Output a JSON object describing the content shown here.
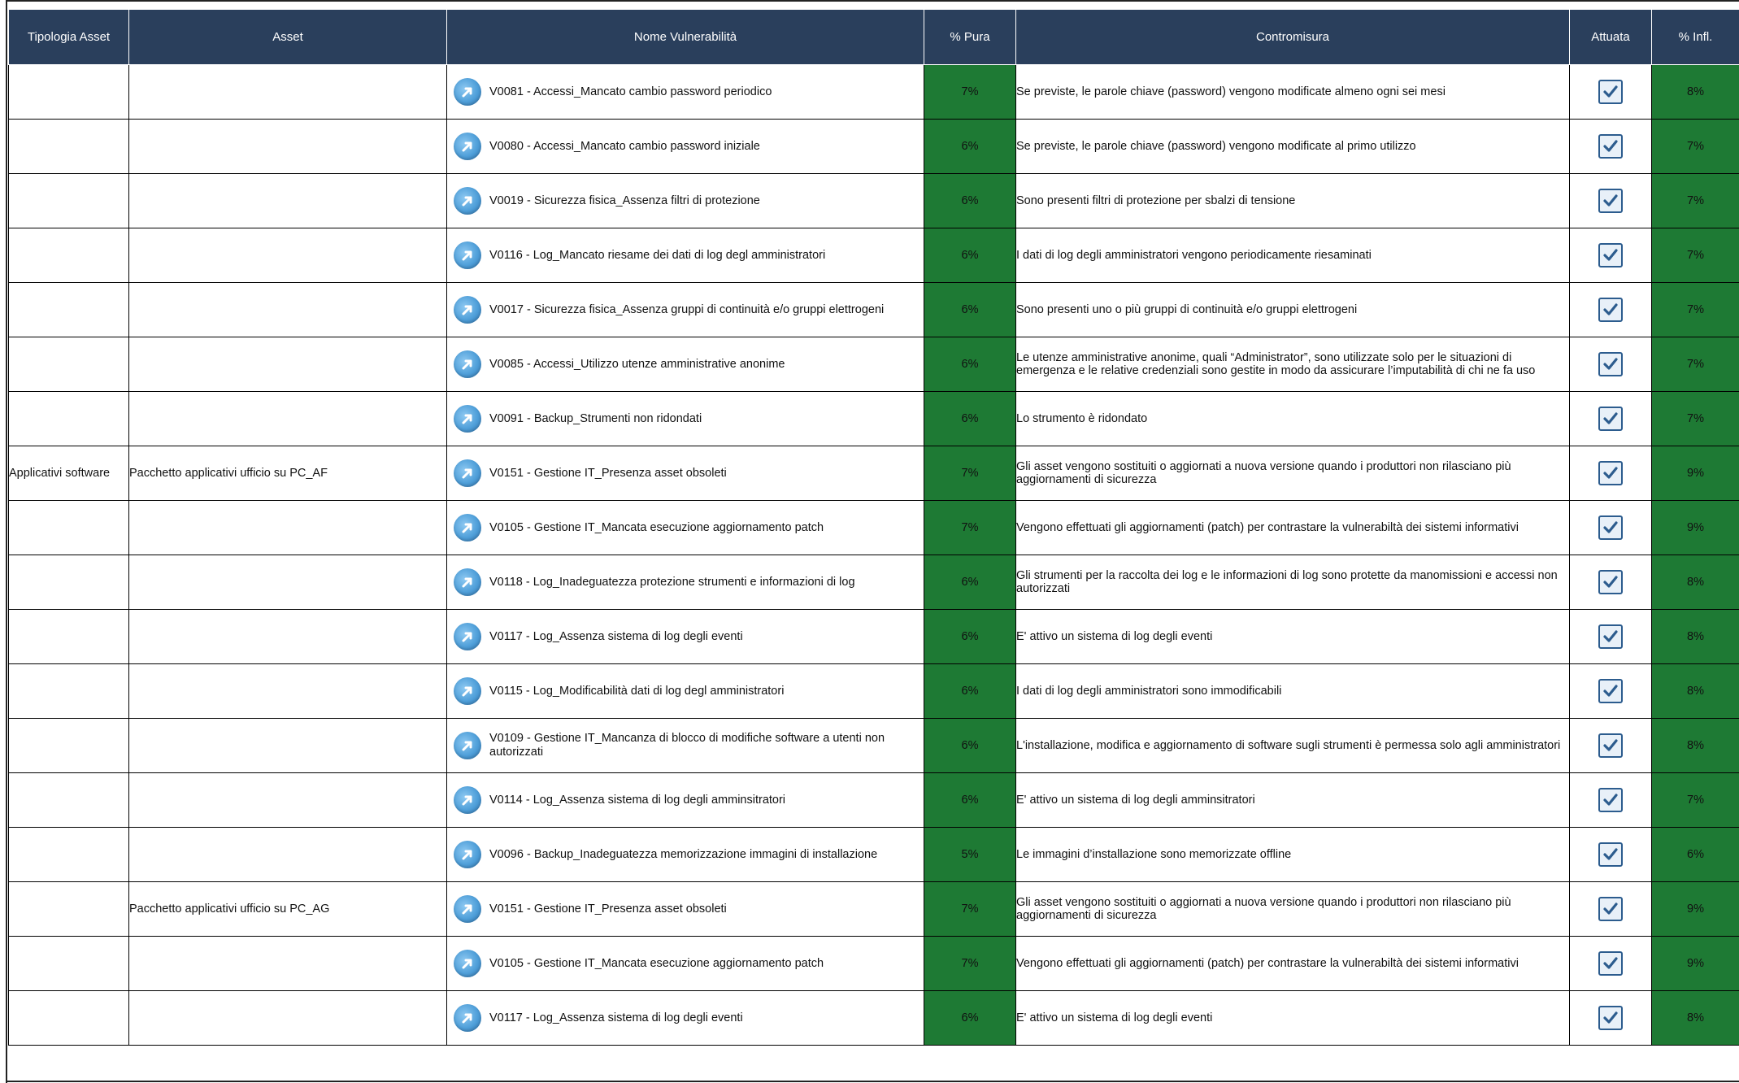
{
  "headers": {
    "tipologia": "Tipologia Asset",
    "asset": "Asset",
    "nome": "Nome Vulnerabilità",
    "pura": "% Pura",
    "contromisura": "Contromisura",
    "attuata": "Attuata",
    "infl": "% Infl."
  },
  "colors": {
    "header_bg": "#2a3f5c",
    "pct_bg": "#1e7a34",
    "pct_text": "#0b4d1d",
    "icon_blue": "#4f9fd9"
  },
  "icons": {
    "vuln": "arrow-circle-icon",
    "attuata": "checkbox-checked-icon"
  },
  "rows": [
    {
      "tipologia": "",
      "asset": "",
      "nome": "V0081 - Accessi_Mancato cambio password periodico",
      "pura": "7%",
      "contromisura": "Se previste, le parole chiave (password) vengono modificate almeno ogni sei mesi",
      "attuata": true,
      "infl": "8%"
    },
    {
      "tipologia": "",
      "asset": "",
      "nome": "V0080 - Accessi_Mancato cambio password iniziale",
      "pura": "6%",
      "contromisura": "Se previste, le parole chiave (password) vengono modificate al primo utilizzo",
      "attuata": true,
      "infl": "7%"
    },
    {
      "tipologia": "",
      "asset": "",
      "nome": "V0019 - Sicurezza fisica_Assenza filtri di protezione",
      "pura": "6%",
      "contromisura": "Sono presenti filtri di protezione per sbalzi di tensione",
      "attuata": true,
      "infl": "7%"
    },
    {
      "tipologia": "",
      "asset": "",
      "nome": "V0116 - Log_Mancato riesame dei dati di log degl amministratori",
      "pura": "6%",
      "contromisura": "I dati di log degli amministratori vengono periodicamente riesaminati",
      "attuata": true,
      "infl": "7%"
    },
    {
      "tipologia": "",
      "asset": "",
      "nome": "V0017 - Sicurezza fisica_Assenza gruppi di continuità e/o gruppi elettrogeni",
      "pura": "6%",
      "contromisura": "Sono presenti uno o più gruppi di continuità e/o gruppi elettrogeni",
      "attuata": true,
      "infl": "7%"
    },
    {
      "tipologia": "",
      "asset": "",
      "nome": "V0085 - Accessi_Utilizzo utenze amministrative anonime",
      "pura": "6%",
      "contromisura": "Le utenze amministrative anonime, quali “Administrator”, sono utilizzate solo per le situazioni di emergenza e le relative credenziali sono gestite in modo da assicurare l’imputabilità di chi ne fa uso",
      "attuata": true,
      "infl": "7%"
    },
    {
      "tipologia": "",
      "asset": "",
      "nome": "V0091 - Backup_Strumenti non ridondati",
      "pura": "6%",
      "contromisura": "Lo strumento è ridondato",
      "attuata": true,
      "infl": "7%"
    },
    {
      "tipologia": "Applicativi software",
      "asset": "Pacchetto applicativi ufficio su PC_AF",
      "nome": "V0151 - Gestione IT_Presenza asset obsoleti",
      "pura": "7%",
      "contromisura": "Gli asset vengono sostituiti o aggiornati a nuova versione quando i produttori non rilasciano più aggiornamenti di sicurezza",
      "attuata": true,
      "infl": "9%"
    },
    {
      "tipologia": "",
      "asset": "",
      "nome": "V0105 - Gestione IT_Mancata esecuzione aggiornamento patch",
      "pura": "7%",
      "contromisura": "Vengono effettuati gli aggiornamenti (patch) per contrastare la vulnerabiltà dei sistemi informativi",
      "attuata": true,
      "infl": "9%"
    },
    {
      "tipologia": "",
      "asset": "",
      "nome": "V0118 - Log_Inadeguatezza protezione strumenti e informazioni di log",
      "pura": "6%",
      "contromisura": "Gli strumenti per la raccolta dei log e le informazioni di log sono protette da manomissioni e accessi non autorizzati",
      "attuata": true,
      "infl": "8%"
    },
    {
      "tipologia": "",
      "asset": "",
      "nome": "V0117 - Log_Assenza sistema di log degli  eventi",
      "pura": "6%",
      "contromisura": "E' attivo un sistema di log degli eventi",
      "attuata": true,
      "infl": "8%"
    },
    {
      "tipologia": "",
      "asset": "",
      "nome": "V0115 - Log_Modificabilità dati di log degl amministratori",
      "pura": "6%",
      "contromisura": "I dati di log degli amministratori sono immodificabili",
      "attuata": true,
      "infl": "8%"
    },
    {
      "tipologia": "",
      "asset": "",
      "nome": "V0109 - Gestione IT_Mancanza di blocco di modifiche software a utenti non autorizzati",
      "pura": "6%",
      "contromisura": "L'installazione, modifica e aggiornamento di  software sugli strumenti è permessa solo agli amministratori",
      "attuata": true,
      "infl": "8%"
    },
    {
      "tipologia": "",
      "asset": "",
      "nome": "V0114 - Log_Assenza sistema di log degli amminsitratori",
      "pura": "6%",
      "contromisura": "E' attivo un sistema di log degli amminsitratori",
      "attuata": true,
      "infl": "7%"
    },
    {
      "tipologia": "",
      "asset": "",
      "nome": "V0096 - Backup_Inadeguatezza memorizzazione immagini di installazione",
      "pura": "5%",
      "contromisura": "Le immagini d’installazione sono memorizzate offline",
      "attuata": true,
      "infl": "6%"
    },
    {
      "tipologia": "",
      "asset": "Pacchetto applicativi ufficio su PC_AG",
      "nome": "V0151 - Gestione IT_Presenza asset obsoleti",
      "pura": "7%",
      "contromisura": "Gli asset vengono sostituiti o aggiornati a nuova versione quando i produttori non rilasciano più aggiornamenti di sicurezza",
      "attuata": true,
      "infl": "9%"
    },
    {
      "tipologia": "",
      "asset": "",
      "nome": "V0105 - Gestione IT_Mancata esecuzione aggiornamento patch",
      "pura": "7%",
      "contromisura": "Vengono effettuati gli aggiornamenti (patch) per contrastare la vulnerabiltà dei sistemi informativi",
      "attuata": true,
      "infl": "9%"
    },
    {
      "tipologia": "",
      "asset": "",
      "nome": "V0117 - Log_Assenza sistema di log degli  eventi",
      "pura": "6%",
      "contromisura": "E' attivo un sistema di log degli eventi",
      "attuata": true,
      "infl": "8%"
    }
  ]
}
